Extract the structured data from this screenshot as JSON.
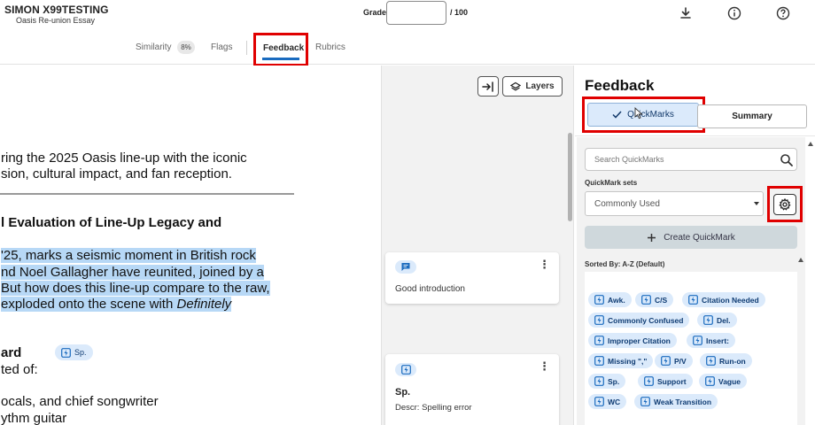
{
  "header": {
    "user_name": "SIMON X99TESTING",
    "doc_title": "Oasis Re-union Essay",
    "grade_label": "Grade",
    "grade_value": "",
    "grade_total": "/ 100",
    "icons": [
      "download-icon",
      "info-icon",
      "help-icon"
    ]
  },
  "tabs": {
    "similarity": "Similarity",
    "similarity_badge": "8%",
    "flags": "Flags",
    "feedback": "Feedback",
    "rubrics": "Rubrics",
    "active": "Feedback"
  },
  "document": {
    "lines": [
      "ring the 2025 Oasis line-up with the iconic",
      "sion, cultural impact, and fan reception.",
      "l Evaluation of Line-Up Legacy and",
      "'25, marks a seismic moment in British rock",
      "nd Noel Gallagher have reunited, joined by a",
      " But how does this line-up compare to the raw,",
      " exploded onto the scene with ",
      "Definitely",
      "ard",
      "ted of:",
      "ocals, and chief songwriter",
      "ythm guitar"
    ],
    "inline_mark": "Sp."
  },
  "comments": {
    "layers_label": "Layers",
    "cards": [
      {
        "title": "",
        "text": "Good introduction"
      },
      {
        "title": "Sp.",
        "text": "Descr: Spelling error"
      }
    ]
  },
  "feedback_panel": {
    "title": "Feedback",
    "quickmarks_label": "QuickMarks",
    "summary_label": "Summary",
    "search_placeholder": "Search QuickMarks",
    "sets_label": "QuickMark sets",
    "sets_value": "Commonly Used",
    "create_label": "Create QuickMark",
    "sorted_label": "Sorted By: A-Z (Default)",
    "quickmarks": [
      "Awk.",
      "C/S",
      "Citation Needed",
      "Commonly Confused",
      "Del.",
      "Improper Citation",
      "Insert:",
      "Missing \",\"",
      "P/V",
      "Run-on",
      "Sp.",
      "Support",
      "Vague",
      "WC",
      "Weak Transition"
    ]
  },
  "colors": {
    "accent": "#1a6bbf",
    "chip_bg": "#dbeafb",
    "highlight_box": "#e00000",
    "text_highlight": "#b7d8f6"
  }
}
